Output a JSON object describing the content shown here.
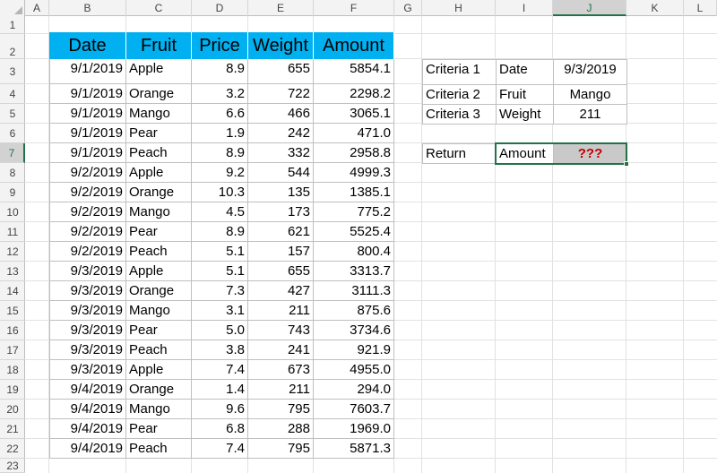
{
  "column_headers": [
    "A",
    "B",
    "C",
    "D",
    "E",
    "F",
    "G",
    "H",
    "I",
    "J",
    "K",
    "L"
  ],
  "row_numbers": [
    "1",
    "2",
    "3",
    "4",
    "5",
    "6",
    "7",
    "8",
    "9",
    "10",
    "11",
    "12",
    "13",
    "14",
    "15",
    "16",
    "17",
    "18",
    "19",
    "20",
    "21",
    "22",
    "23"
  ],
  "data_table": {
    "headers": [
      "Date",
      "Fruit",
      "Price",
      "Weight",
      "Amount"
    ],
    "rows": [
      [
        "9/1/2019",
        "Apple",
        "8.9",
        "655",
        "5854.1"
      ],
      [
        "9/1/2019",
        "Orange",
        "3.2",
        "722",
        "2298.2"
      ],
      [
        "9/1/2019",
        "Mango",
        "6.6",
        "466",
        "3065.1"
      ],
      [
        "9/1/2019",
        "Pear",
        "1.9",
        "242",
        "471.0"
      ],
      [
        "9/1/2019",
        "Peach",
        "8.9",
        "332",
        "2958.8"
      ],
      [
        "9/2/2019",
        "Apple",
        "9.2",
        "544",
        "4999.3"
      ],
      [
        "9/2/2019",
        "Orange",
        "10.3",
        "135",
        "1385.1"
      ],
      [
        "9/2/2019",
        "Mango",
        "4.5",
        "173",
        "775.2"
      ],
      [
        "9/2/2019",
        "Pear",
        "8.9",
        "621",
        "5525.4"
      ],
      [
        "9/2/2019",
        "Peach",
        "5.1",
        "157",
        "800.4"
      ],
      [
        "9/3/2019",
        "Apple",
        "5.1",
        "655",
        "3313.7"
      ],
      [
        "9/3/2019",
        "Orange",
        "7.3",
        "427",
        "3111.3"
      ],
      [
        "9/3/2019",
        "Mango",
        "3.1",
        "211",
        "875.6"
      ],
      [
        "9/3/2019",
        "Pear",
        "5.0",
        "743",
        "3734.6"
      ],
      [
        "9/3/2019",
        "Peach",
        "3.8",
        "241",
        "921.9"
      ],
      [
        "9/3/2019",
        "Apple",
        "7.4",
        "673",
        "4955.0"
      ],
      [
        "9/4/2019",
        "Orange",
        "1.4",
        "211",
        "294.0"
      ],
      [
        "9/4/2019",
        "Mango",
        "9.6",
        "795",
        "7603.7"
      ],
      [
        "9/4/2019",
        "Pear",
        "6.8",
        "288",
        "1969.0"
      ],
      [
        "9/4/2019",
        "Peach",
        "7.4",
        "795",
        "5871.3"
      ]
    ]
  },
  "criteria": [
    {
      "label": "Criteria 1",
      "field": "Date",
      "value": "9/3/2019"
    },
    {
      "label": "Criteria 2",
      "field": "Fruit",
      "value": "Mango"
    },
    {
      "label": "Criteria 3",
      "field": "Weight",
      "value": "211"
    }
  ],
  "return_row": {
    "label": "Return",
    "field": "Amount",
    "value": "???"
  },
  "colors": {
    "header_fill": "#00b0f0",
    "return_fill": "#c9c9c9",
    "return_text": "#c00000",
    "selection": "#217346"
  }
}
